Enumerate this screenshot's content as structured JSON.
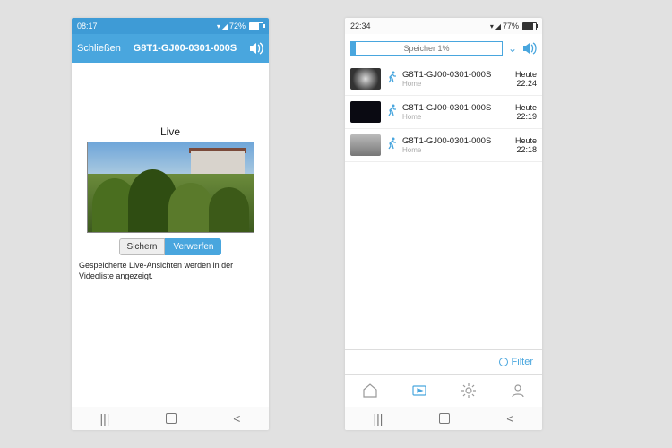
{
  "left": {
    "status": {
      "time": "08:17",
      "battery": "72%"
    },
    "header": {
      "close": "Schließen",
      "title": "G8T1-GJ00-0301-000S"
    },
    "live_label": "Live",
    "buttons": {
      "save": "Sichern",
      "discard": "Verwerfen"
    },
    "hint": "Gespeicherte Live-Ansichten werden in der Videoliste angezeigt."
  },
  "right": {
    "status": {
      "time": "22:34",
      "battery": "77%"
    },
    "storage_label": "Speicher 1%",
    "events": [
      {
        "name": "G8T1-GJ00-0301-000S",
        "sub": "Home",
        "day": "Heute",
        "time": "22:24",
        "thumb": "t1"
      },
      {
        "name": "G8T1-GJ00-0301-000S",
        "sub": "Home",
        "day": "Heute",
        "time": "22:19",
        "thumb": "t2"
      },
      {
        "name": "G8T1-GJ00-0301-000S",
        "sub": "Home",
        "day": "Heute",
        "time": "22:18",
        "thumb": "t3"
      }
    ],
    "filter_label": "Filter"
  }
}
